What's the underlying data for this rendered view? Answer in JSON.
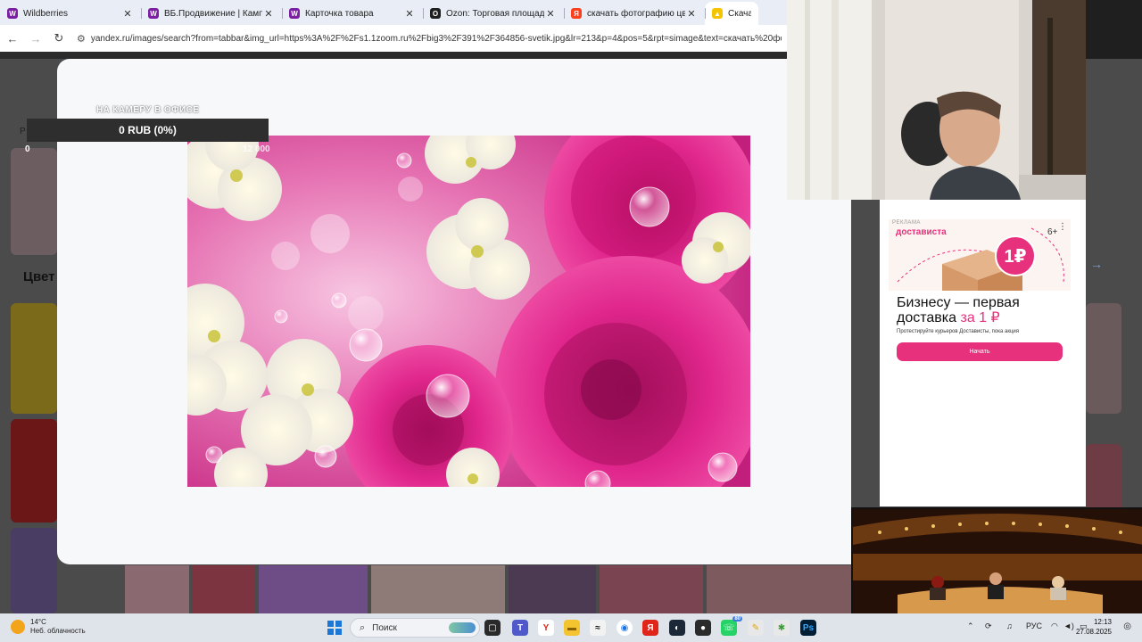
{
  "browser": {
    "tabs": [
      {
        "title": "Wildberries",
        "favicon": "wildberries-icon",
        "color": "#7b1fa2",
        "glyph": "W"
      },
      {
        "title": "ВБ.Продвижение | Кампании",
        "favicon": "wildberries-icon",
        "color": "#7b1fa2",
        "glyph": "W"
      },
      {
        "title": "Карточка товара",
        "favicon": "wildberries-icon",
        "color": "#7b1fa2",
        "glyph": "W"
      },
      {
        "title": "Ozon: Торговая площадка",
        "favicon": "ozon-icon",
        "color": "#1f1f1f",
        "glyph": "O"
      },
      {
        "title": "скачать фотографию цветов -",
        "favicon": "yandex-icon",
        "color": "#fc3f1d",
        "glyph": "Я"
      },
      {
        "title": "Скачать фо",
        "favicon": "yandex-images-icon",
        "color": "#f5c400",
        "glyph": "▲",
        "active": true
      }
    ],
    "url": "yandex.ru/images/search?from=tabbar&img_url=https%3A%2F%2Fs1.1zoom.ru%2Fbig3%2F391%2F364856-svetik.jpg&lr=213&p=4&pos=5&rpt=simage&text=скачать%20фотографию%2..."
  },
  "stream_overlay": {
    "title": "НА КАМЕРУ В ОФИСЕ",
    "donation_text": "0 RUB (0%)",
    "donation_start": "0",
    "donation_goal": "12 000"
  },
  "background_page": {
    "letter": "Р",
    "heading": "Цвет"
  },
  "ad": {
    "label": "РЕКЛАМА",
    "brand": "достависта",
    "age": "6+",
    "badge": "1₽",
    "headline_main": "Бизнесу — первая доставка ",
    "headline_accent": "за 1 ₽",
    "subtext": "Протестируйте курьеров Достависты, пока акция",
    "cta": "Начать",
    "accent_color": "#e8317d"
  },
  "taskbar": {
    "weather_temp": "14°C",
    "weather_desc": "Неб. облачность",
    "search_label": "Поиск",
    "whatsapp_badge": "80",
    "lang": "РУС",
    "time": "12:13",
    "date": "27.08.2025"
  }
}
